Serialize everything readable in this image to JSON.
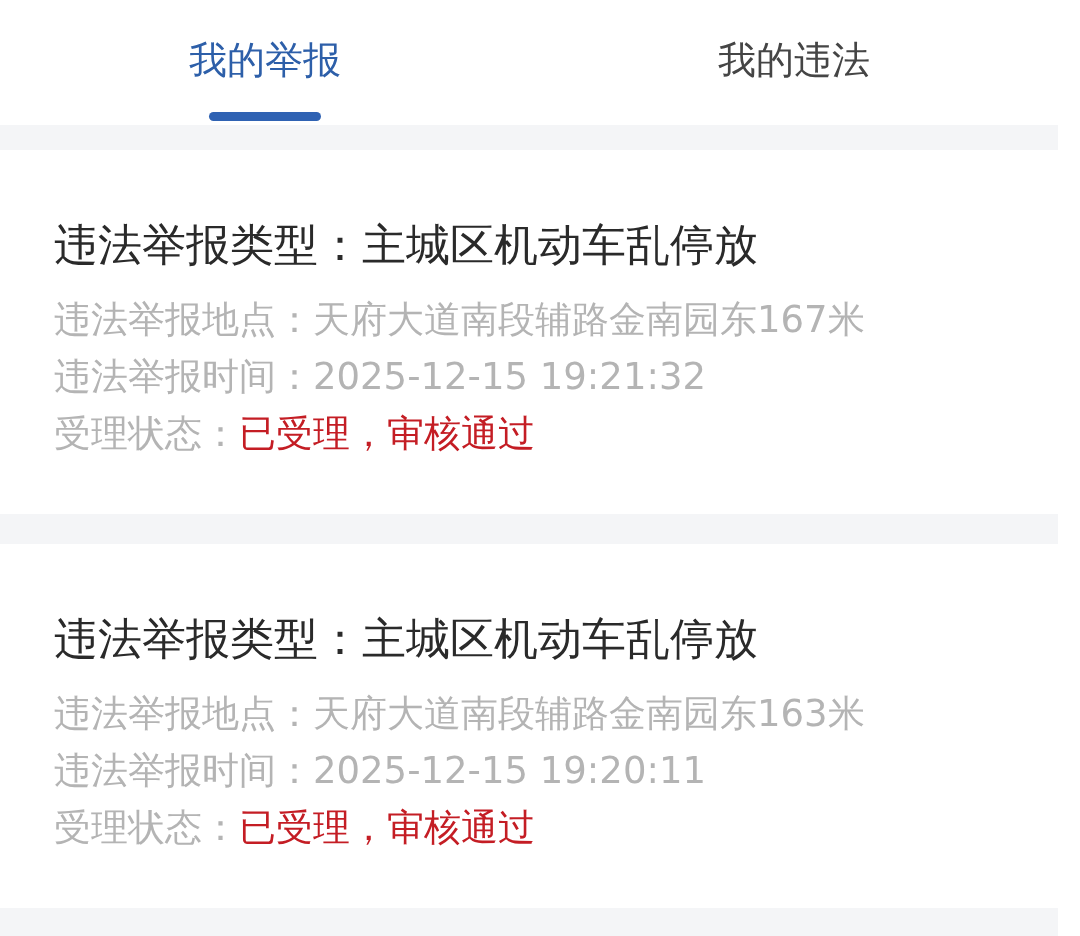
{
  "tabs": [
    {
      "label": "我的举报",
      "selected": true
    },
    {
      "label": "我的违法",
      "selected": false
    }
  ],
  "reports": [
    {
      "type": "违法举报类型：主城区机动车乱停放",
      "location": "违法举报地点：天府大道南段辅路金南园东167米",
      "time": "违法举报时间：2025-12-15 19:21:32",
      "status_label": "受理状态：",
      "status_value": "已受理，审核通过"
    },
    {
      "type": "违法举报类型：主城区机动车乱停放",
      "location": "违法举报地点：天府大道南段辅路金南园东163米",
      "time": "违法举报时间：2025-12-15 19:20:11",
      "status_label": "受理状态：",
      "status_value": "已受理，审核通过"
    }
  ]
}
